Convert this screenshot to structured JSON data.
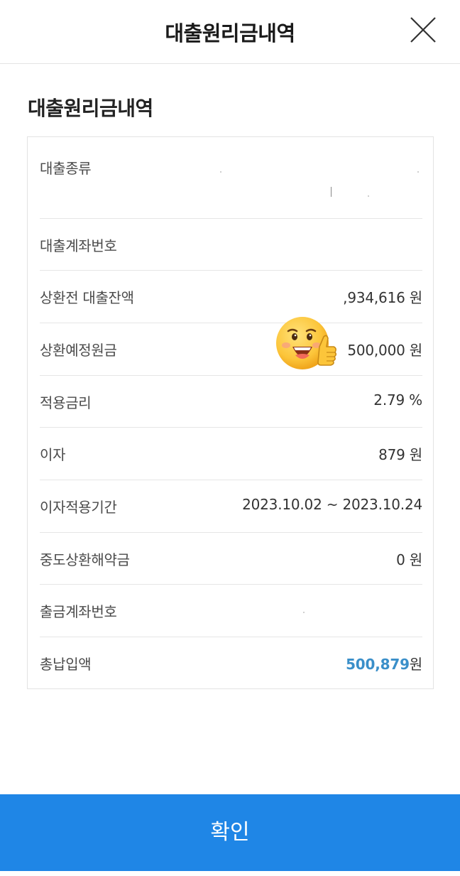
{
  "header": {
    "title": "대출원리금내역",
    "close_icon": "close-icon"
  },
  "section": {
    "title": "대출원리금내역"
  },
  "details": [
    {
      "label": "대출종류",
      "value": ""
    },
    {
      "label": "대출계좌번호",
      "value": ""
    },
    {
      "label": "상환전 대출잔액",
      "value": ",934,616 원"
    },
    {
      "label": "상환예정원금",
      "value": "500,000 원"
    },
    {
      "label": "적용금리",
      "value": "2.79 %"
    },
    {
      "label": "이자",
      "value": "879 원"
    },
    {
      "label": "이자적용기간",
      "value": "2023.10.02 ~ 2023.10.24"
    },
    {
      "label": "중도상환해약금",
      "value": "0 원"
    },
    {
      "label": "출금계좌번호",
      "value": ""
    },
    {
      "label": "총납입액",
      "value": "500,879",
      "unit": "원"
    }
  ],
  "sticker": "thumbs-up-smiley-sticker",
  "colors": {
    "accent": "#3a8fc9",
    "button": "#1f86e6"
  },
  "footer": {
    "confirm_label": "확인"
  }
}
